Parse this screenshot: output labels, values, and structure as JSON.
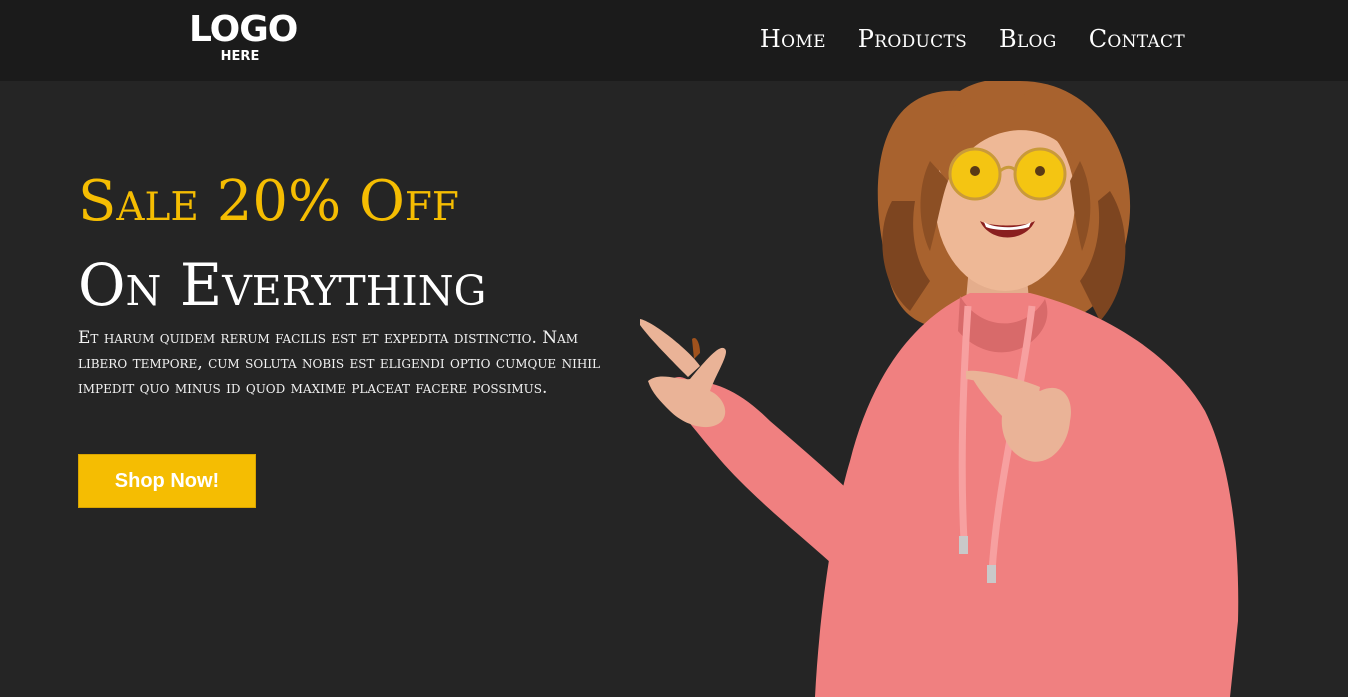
{
  "logo": {
    "main": "LOGO",
    "sub": "HERE"
  },
  "nav": {
    "items": [
      {
        "label": "Home"
      },
      {
        "label": "Products"
      },
      {
        "label": "Blog"
      },
      {
        "label": "Contact"
      }
    ]
  },
  "hero": {
    "headline_1": "Sale 20% Off",
    "headline_2": "On Everything",
    "description": "Et harum quidem rerum facilis est et expedita distinctio. Nam libero tempore, cum soluta nobis est eligendi optio cumque nihil impedit quo minus id quod maxime placeat facere possimus.",
    "cta_label": "Shop Now!",
    "image_subject": "woman-in-pink-hoodie-pointing"
  },
  "colors": {
    "navbar_bg": "#1b1b1b",
    "page_bg": "#252525",
    "accent": "#f5bd02",
    "text": "#ffffff",
    "hoodie": "#f08080"
  }
}
